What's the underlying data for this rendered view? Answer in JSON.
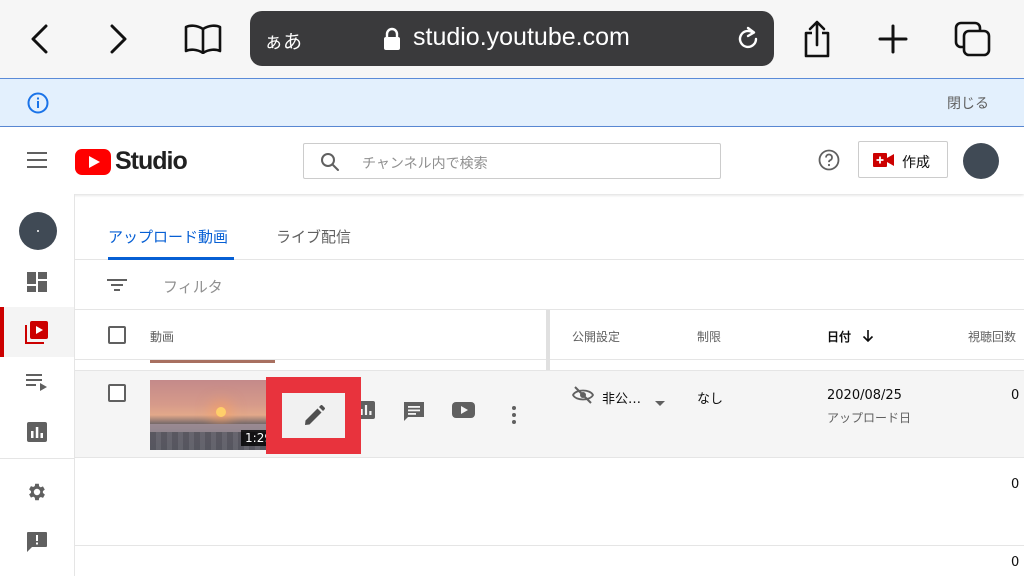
{
  "browser": {
    "text_size_label": "ぁあ",
    "url": "studio.youtube.com"
  },
  "banner": {
    "close_label": "閉じる"
  },
  "header": {
    "logo_text": "Studio",
    "search_placeholder": "チャンネル内で検索",
    "create_label": "作成"
  },
  "tabs": [
    {
      "label": "アップロード動画",
      "active": true
    },
    {
      "label": "ライブ配信",
      "active": false
    }
  ],
  "filter": {
    "label": "フィルタ"
  },
  "columns": {
    "video": "動画",
    "visibility": "公開設定",
    "restrictions": "制限",
    "date": "日付",
    "views": "視聴回数"
  },
  "rows": [
    {
      "duration": "1:29",
      "visibility": "非公…",
      "restrictions": "なし",
      "date": "2020/08/25",
      "date_sub": "アップロード日",
      "views": "0"
    }
  ],
  "extra_counts": [
    "0",
    "0"
  ],
  "colors": {
    "accent_blue": "#065fd4",
    "brand_red": "#ff0000",
    "highlight_red": "#e8333d",
    "banner_bg": "#e3f0fd"
  }
}
